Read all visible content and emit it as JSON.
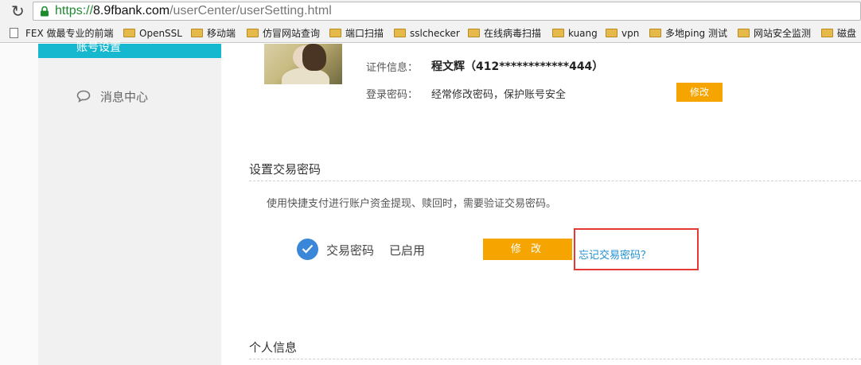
{
  "browser": {
    "url_scheme": "https://",
    "url_host": "8.9fbank.com",
    "url_path": "/userCenter/userSetting.html",
    "bookmarks": [
      {
        "label": "FEX 做最专业的前端",
        "icon": "page-icon"
      },
      {
        "label": "OpenSSL",
        "icon": "folder-icon"
      },
      {
        "label": "移动端",
        "icon": "folder-icon"
      },
      {
        "label": "仿冒网站查询",
        "icon": "folder-icon"
      },
      {
        "label": "端口扫描",
        "icon": "folder-icon"
      },
      {
        "label": "sslchecker",
        "icon": "folder-icon"
      },
      {
        "label": "在线病毒扫描",
        "icon": "folder-icon"
      },
      {
        "label": "kuang",
        "icon": "folder-icon"
      },
      {
        "label": "vpn",
        "icon": "folder-icon"
      },
      {
        "label": "多地ping 测试",
        "icon": "folder-icon"
      },
      {
        "label": "网站安全监测",
        "icon": "folder-icon"
      },
      {
        "label": "磁盘",
        "icon": "folder-icon"
      }
    ]
  },
  "sidebar": {
    "active_item": "账号设置",
    "items": [
      {
        "label": "消息中心",
        "icon": "message-bubble-icon"
      }
    ]
  },
  "account": {
    "id_label": "证件信息：",
    "id_value": "程文辉（412************444）",
    "password_label": "登录密码：",
    "password_hint": "经常修改密码，保护账号安全",
    "password_edit": "修改"
  },
  "trade_password": {
    "title": "设置交易密码",
    "description": "使用快捷支付进行账户资金提现、赎回时，需要验证交易密码。",
    "label": "交易密码",
    "status": "已启用",
    "edit_button": "修 改",
    "forgot_link": "忘记交易密码？",
    "accent_color": "#f5a400",
    "highlight_color": "#e53935"
  },
  "personal_info": {
    "title": "个人信息"
  }
}
